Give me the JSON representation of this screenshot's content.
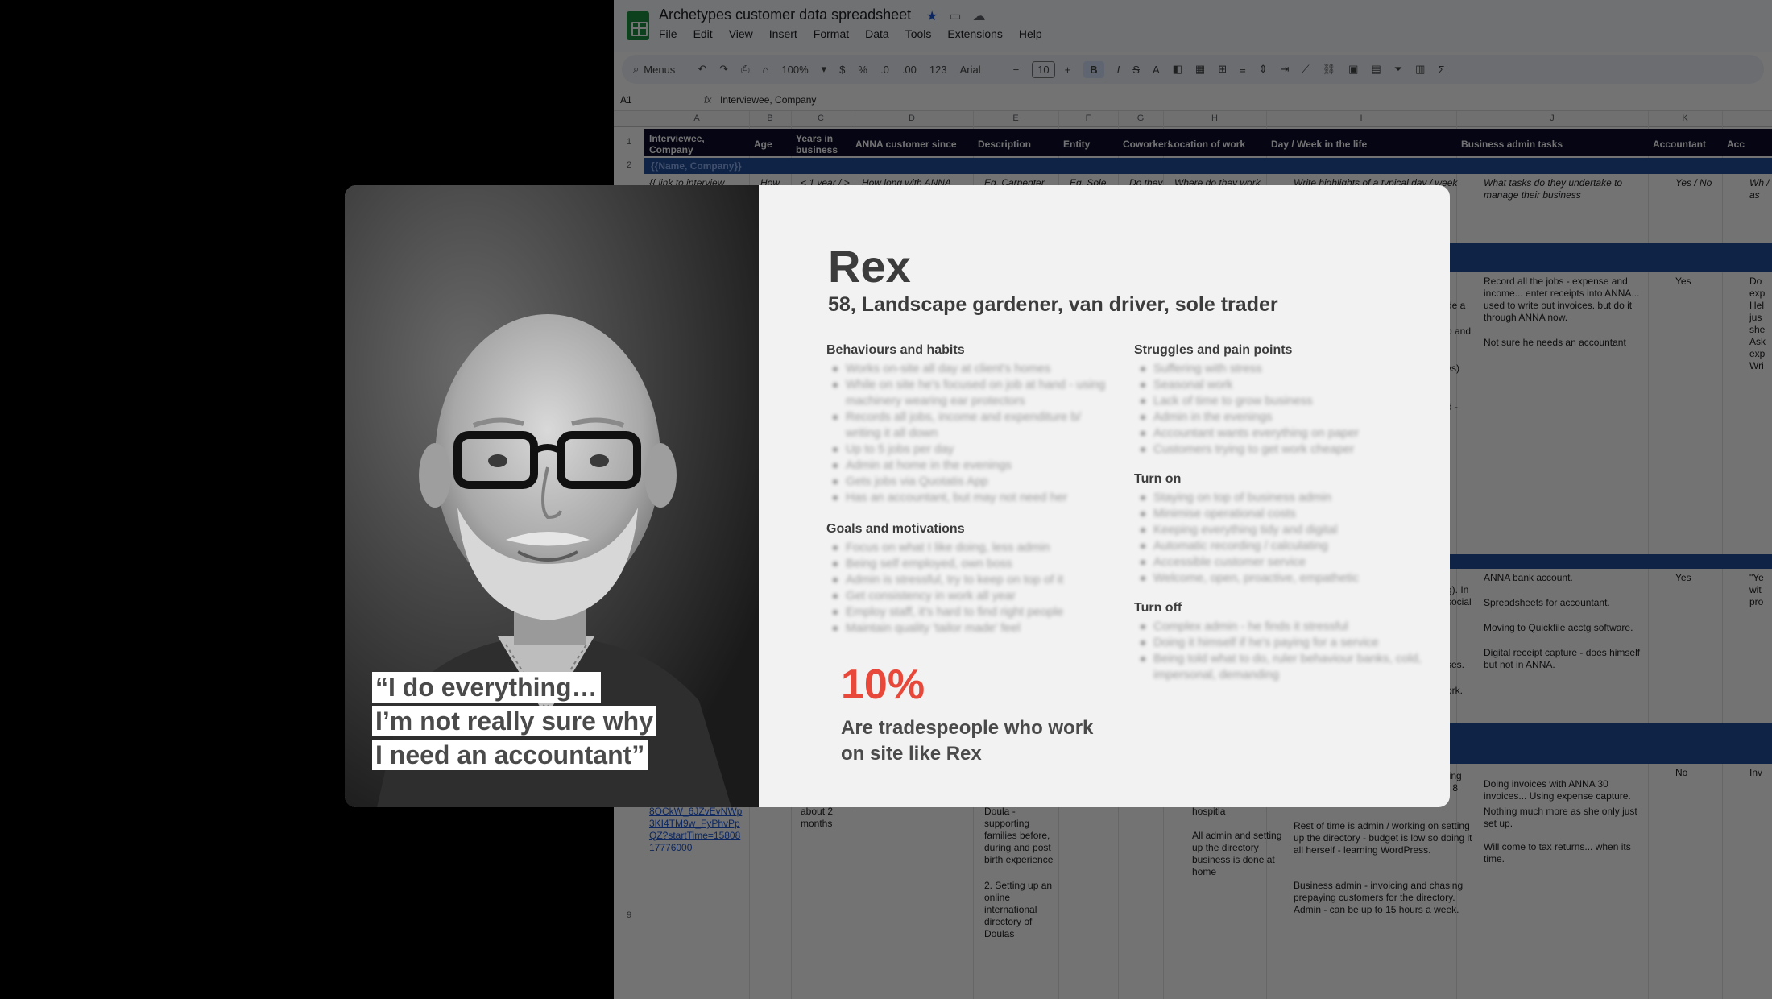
{
  "sheet": {
    "title": "Archetypes customer data spreadsheet",
    "menu": [
      "File",
      "Edit",
      "View",
      "Insert",
      "Format",
      "Data",
      "Tools",
      "Extensions",
      "Help"
    ],
    "toolbar": {
      "search": "Menus",
      "zoom": "100%",
      "currency": "$",
      "percent": "%",
      "dec_minus": ".0",
      "dec_plus": ".00",
      "number_format": "123",
      "font": "Arial",
      "font_size": "10",
      "bold": "B",
      "italic": "I",
      "strike": "S",
      "text_color": "A",
      "sum": "Σ"
    },
    "name_box": "A1",
    "formula": "Interviewee, Company",
    "columns": [
      "A",
      "B",
      "C",
      "D",
      "E",
      "F",
      "G",
      "H",
      "I",
      "J",
      "K"
    ],
    "headers": [
      "Interviewee, Company",
      "Age",
      "Years in business",
      "ANNA customer since",
      "Description",
      "Entity",
      "Coworkers",
      "Location of work",
      "Day / Week in the life",
      "Business admin tasks",
      "Accountant",
      "Acc"
    ],
    "row2_value": "{{Name, Company}}",
    "row3": {
      "a": "{{ link to interview",
      "b": "How",
      "c": "< 1 year / >",
      "d": "How long with ANNA",
      "e": "Eg. Carpenter",
      "f": "Eg. Sole",
      "g": "Do they",
      "h": "Where do they work",
      "i": "Write highlights of a typical day / week",
      "j": "What tasks do they undertake to manage their business",
      "k": "Yes / No",
      "l": "Wh / as"
    },
    "row_j1": "Record all the jobs - expense and income... enter receipts into ANNA... used to write out invoices. but do it through ANNA now.",
    "row_j1b": "Not sure he needs an accountant",
    "row_k1": "Yes",
    "row_l1": "Do exp Hel jus she Ask exp Wri",
    "row_i_frag": [
      "de a",
      "o and",
      "ys)",
      "d -"
    ],
    "row_j2": [
      "ANNA bank account.",
      "Spreadsheets for accountant.",
      "Moving to Quickfile acctg software.",
      "Digital receipt capture - does himself but not in ANNA."
    ],
    "row_k2": "Yes",
    "row_l2": "\"Ye wit pro",
    "row_i2_frag": [
      "g). In",
      "social",
      "ses.",
      "ork."
    ],
    "row_last": {
      "a_link": "8OCkW_6JZvEvNWp 3KI4TM9w_FyPhvPp QZ?startTime=15808 17776000",
      "c": "about 2 months",
      "e1": "Doula - supporting families before, during and post birth experience",
      "e2": "2. Setting up an online international directory of Doulas",
      "h1": "hospitla",
      "h2": "All admin and setting up the directory business is done at home",
      "i_top1": "ling",
      "i_top2": "- 8",
      "i1": "Rest of time is admin / working on setting up the directory - budget is low so doing it all herself - learning WordPress.",
      "i2": "Business admin - invoicing and chasing prepaying customers for the directory. Admin - can be up to 15 hours a week.",
      "j1": "Doing invoices with ANNA 30 invoices... Using expense capture.",
      "j2": "Nothing much more as she only just set up.",
      "j3": "Will come to tax returns... when its time.",
      "k": "No",
      "l": "Inv"
    },
    "row_numbers": [
      "1",
      "2",
      "9"
    ]
  },
  "persona": {
    "name": "Rex",
    "subtitle": "58, Landscape gardener, van driver, sole trader",
    "quote_lines": [
      "“I do everything…",
      "I’m not really sure why",
      "I need an accountant”"
    ],
    "behaviours": {
      "title": "Behaviours and habits",
      "items": [
        "Works on-site all day at client's homes",
        "While on site he's focused on job at hand - using machinery wearing ear protectors",
        "Records all jobs, income and expenditure b/ writing it all down",
        "Up to 5 jobs per day",
        "Admin at home in the evenings",
        "Gets jobs via Quotatis App",
        "Has an accountant, but may not need her"
      ]
    },
    "goals": {
      "title": "Goals and motivations",
      "items": [
        "Focus on what I like doing, less admin",
        "Being self employed, own boss",
        "Admin is stressful, try to keep on top of it",
        "Get consistency in work all year",
        "Employ staff, it's hard to find right people",
        "Maintain quality 'tailor made' feel"
      ]
    },
    "struggles": {
      "title": "Struggles and pain points",
      "items": [
        "Suffering with stress",
        "Seasonal work",
        "Lack of time to grow business",
        "Admin in the evenings",
        "Accountant wants everything on paper",
        "Customers trying to get work cheaper"
      ]
    },
    "turn_on": {
      "title": "Turn on",
      "items": [
        "Staying on top of business admin",
        "Minimise operational costs",
        "Keeping everything tidy and digital",
        "Automatic recording / calculating",
        "Accessible customer service",
        "Welcome, open, proactive, empathetic"
      ]
    },
    "turn_off": {
      "title": "Turn off",
      "items": [
        "Complex admin - he finds it stressful",
        "Doing it himself if he's paying for a service",
        "Being told what to do, ruler behaviour banks, cold, impersonal, demanding"
      ]
    },
    "stat": {
      "value": "10%",
      "caption": "Are tradespeople who work on site like Rex"
    },
    "accent_color": "#e8483a"
  }
}
